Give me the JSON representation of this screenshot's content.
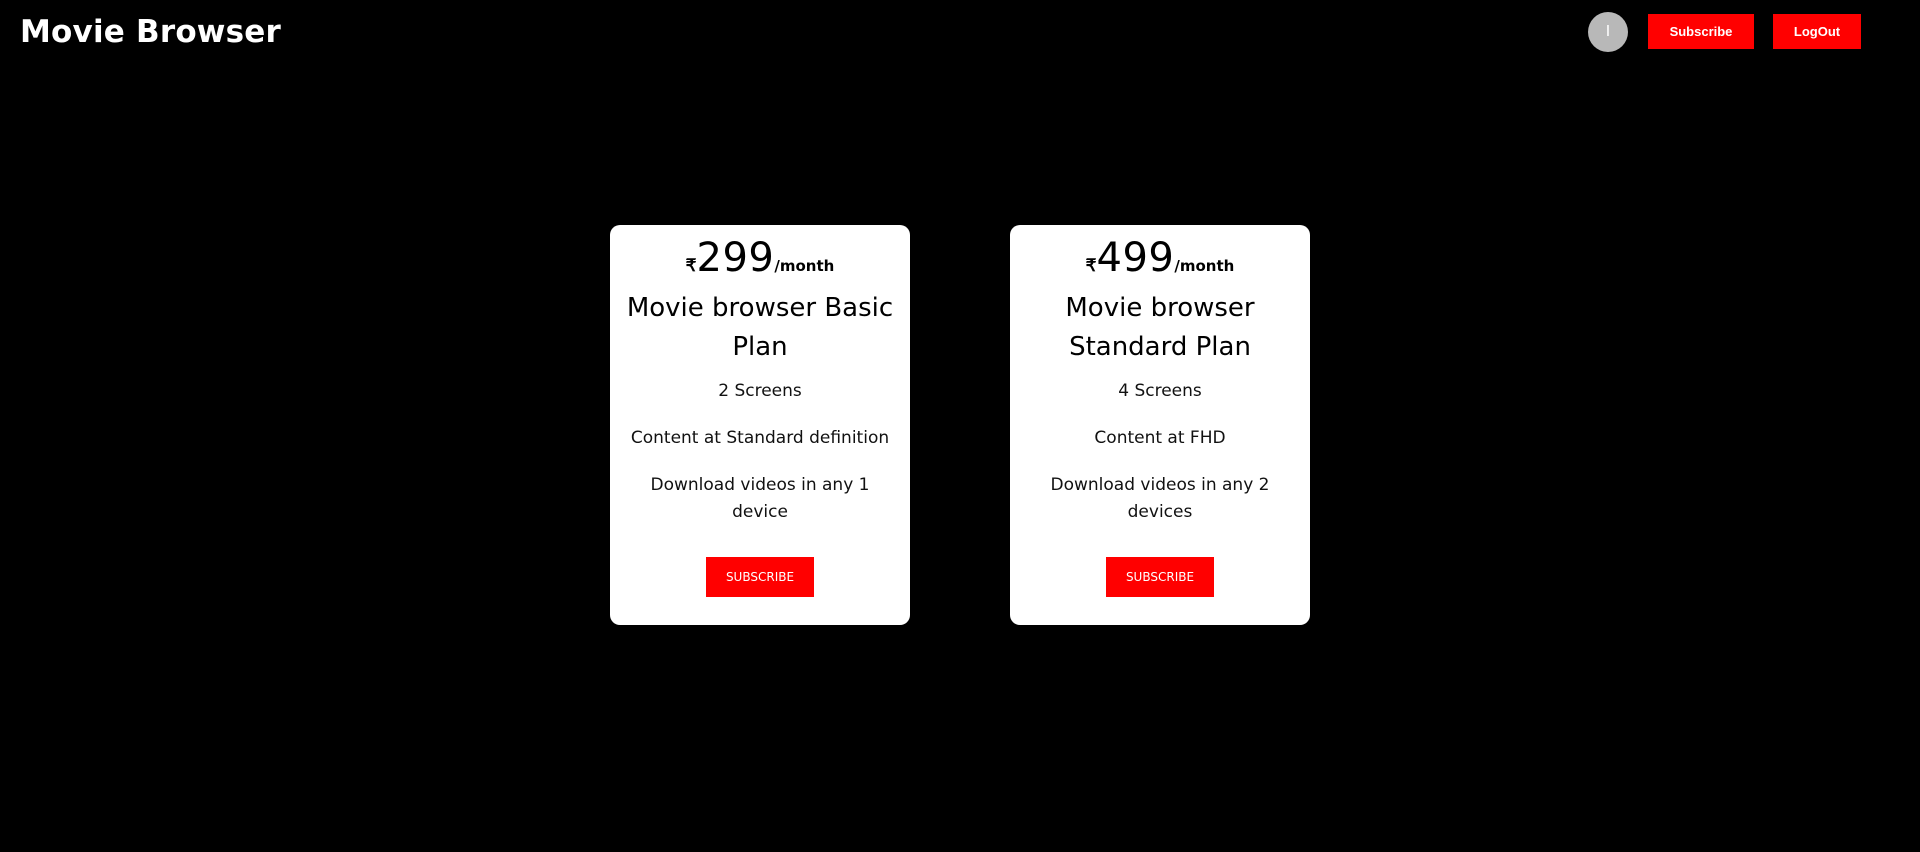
{
  "header": {
    "title": "Movie Browser",
    "avatar_letter": "I",
    "subscribe_label": "Subscribe",
    "logout_label": "LogOut"
  },
  "plans": [
    {
      "currency": "₹",
      "price": "299",
      "period": "/month",
      "name": "Movie browser Basic Plan",
      "features": [
        "2 Screens",
        "Content at Standard definition",
        "Download videos in any 1 device"
      ],
      "button_label": "SUBSCRIBE"
    },
    {
      "currency": "₹",
      "price": "499",
      "period": "/month",
      "name": "Movie browser Standard Plan",
      "features": [
        "4 Screens",
        "Content at FHD",
        "Download videos in any 2 devices"
      ],
      "button_label": "SUBSCRIBE"
    }
  ],
  "colors": {
    "background": "#000000",
    "accent": "#ff0000",
    "card": "#ffffff",
    "avatar": "#b8b8b8"
  }
}
